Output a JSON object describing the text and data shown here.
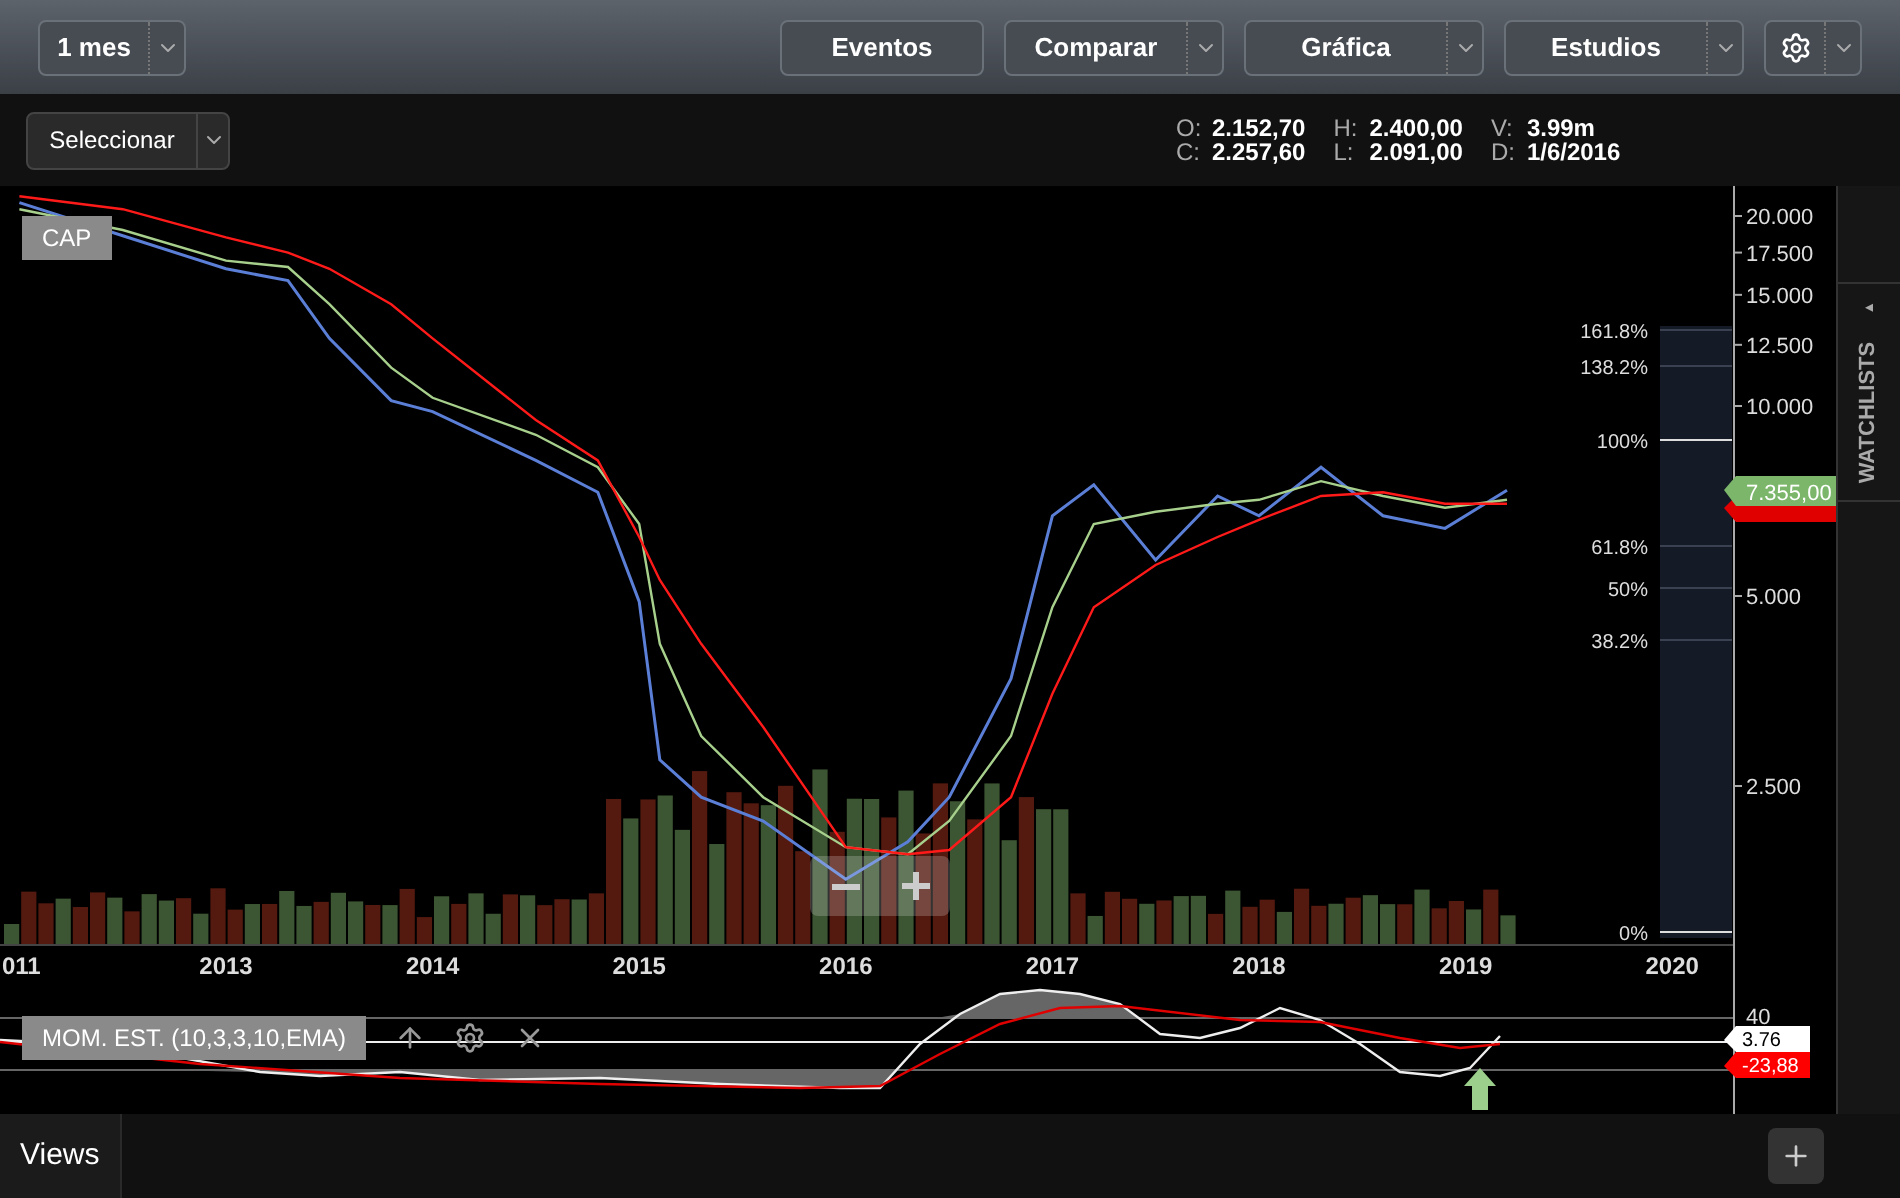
{
  "toolbar": {
    "period": {
      "label": "1 mes"
    },
    "buttons": [
      {
        "label": "Eventos",
        "dropdown": false
      },
      {
        "label": "Comparar",
        "dropdown": true
      },
      {
        "label": "Gráfica",
        "dropdown": true
      },
      {
        "label": "Estudios",
        "dropdown": true
      }
    ]
  },
  "selector": {
    "label": "Seleccionar"
  },
  "ohlc": [
    {
      "key": "O:",
      "value": "2.152,70"
    },
    {
      "key": "C:",
      "value": "2.257,60"
    },
    {
      "key": "H:",
      "value": "2.400,00"
    },
    {
      "key": "L:",
      "value": "2.091,00"
    },
    {
      "key": "V:",
      "value": "3.99m"
    },
    {
      "key": "D:",
      "value": "1/6/2016"
    }
  ],
  "price_chart": {
    "symbol": "CAP",
    "last_price_tag": "7.355,00",
    "x_axis_labels": [
      "011",
      "2013",
      "2014",
      "2015",
      "2016",
      "2017",
      "2018",
      "2019",
      "2020"
    ],
    "y_axis_labels": [
      "20.000",
      "17.500",
      "15.000",
      "12.500",
      "10.000",
      "5.000",
      "2.500"
    ],
    "fibonacci": [
      "161.8%",
      "138.2%",
      "100%",
      "61.8%",
      "50%",
      "38.2%",
      "0%"
    ]
  },
  "oscillator": {
    "label": "MOM. EST. (10,3,3,10,EMA)",
    "axis_label": "40",
    "tags": [
      {
        "text": "3.76",
        "color": "#ffffff"
      },
      {
        "text": "-23,88",
        "color": "#ff0000"
      }
    ]
  },
  "sidebar": {
    "tab": "WATCHLISTS",
    "tab_arrow": "◂"
  },
  "bottom_bar": {
    "tabs": [
      {
        "label": "Views",
        "selected": true
      }
    ]
  }
}
